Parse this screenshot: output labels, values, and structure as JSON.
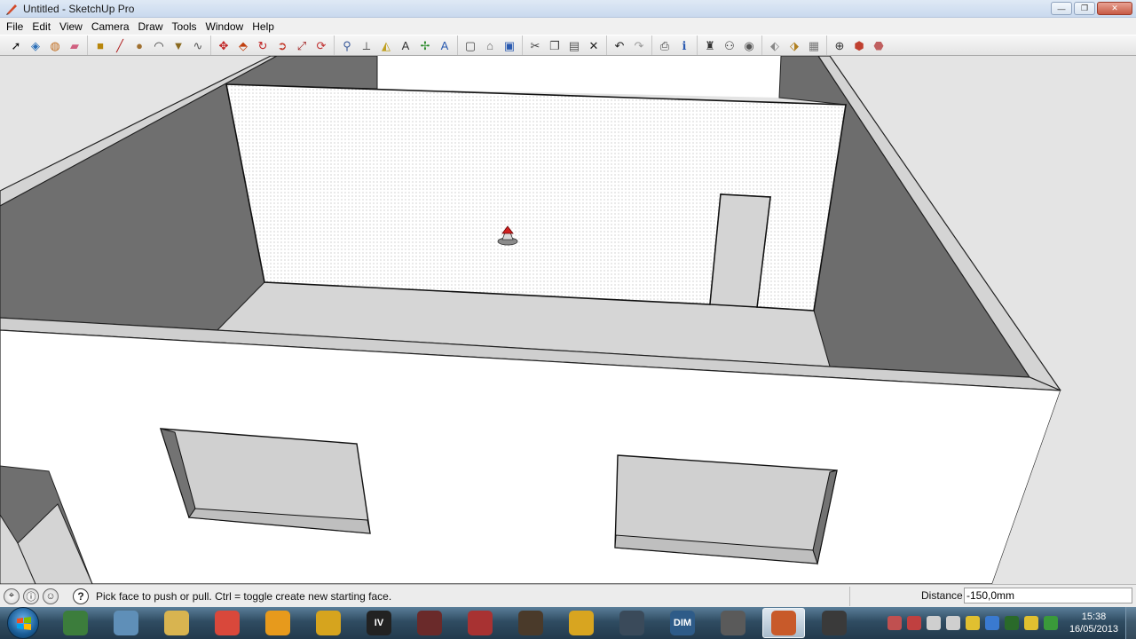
{
  "window": {
    "title": "Untitled - SketchUp Pro",
    "minimize": "—",
    "maximize": "❐",
    "close": "✕"
  },
  "menu": [
    "File",
    "Edit",
    "View",
    "Camera",
    "Draw",
    "Tools",
    "Window",
    "Help"
  ],
  "toolbar": {
    "groups": [
      [
        {
          "name": "select-tool",
          "glyph": "➚",
          "color": "#111111"
        },
        {
          "name": "component-tool",
          "glyph": "◈",
          "color": "#2a6fb8"
        },
        {
          "name": "paint-bucket-tool",
          "glyph": "◍",
          "color": "#c06a1a"
        },
        {
          "name": "eraser-tool",
          "glyph": "▰",
          "color": "#d06080"
        }
      ],
      [
        {
          "name": "rectangle-tool",
          "glyph": "■",
          "color": "#b8860b"
        },
        {
          "name": "line-tool",
          "glyph": "╱",
          "color": "#b02020"
        },
        {
          "name": "circle-tool",
          "glyph": "●",
          "color": "#a07030"
        },
        {
          "name": "arc-tool",
          "glyph": "◠",
          "color": "#333333"
        },
        {
          "name": "polygon-tool",
          "glyph": "▼",
          "color": "#8a6a20"
        },
        {
          "name": "freehand-tool",
          "glyph": "∿",
          "color": "#555555"
        }
      ],
      [
        {
          "name": "move-tool",
          "glyph": "✥",
          "color": "#c02020"
        },
        {
          "name": "push-pull-tool",
          "glyph": "⬘",
          "color": "#c04010"
        },
        {
          "name": "rotate-tool",
          "glyph": "↻",
          "color": "#c02020"
        },
        {
          "name": "follow-me-tool",
          "glyph": "➲",
          "color": "#c03020"
        },
        {
          "name": "scale-tool",
          "glyph": "⤢",
          "color": "#a02020"
        },
        {
          "name": "offset-tool",
          "glyph": "⟳",
          "color": "#c03030"
        }
      ],
      [
        {
          "name": "tape-measure-tool",
          "glyph": "⚲",
          "color": "#3a5a9a"
        },
        {
          "name": "dimension-tool",
          "glyph": "⟂",
          "color": "#555555"
        },
        {
          "name": "protractor-tool",
          "glyph": "◭",
          "color": "#c0a020"
        },
        {
          "name": "text-tool",
          "glyph": "A",
          "color": "#333333"
        },
        {
          "name": "axes-tool",
          "glyph": "✢",
          "color": "#2a8a2a"
        },
        {
          "name": "3d-text-tool",
          "glyph": "A",
          "color": "#2a5ab0"
        }
      ],
      [
        {
          "name": "new-icon",
          "glyph": "▢",
          "color": "#444444"
        },
        {
          "name": "open-icon",
          "glyph": "⌂",
          "color": "#666666"
        },
        {
          "name": "save-icon",
          "glyph": "▣",
          "color": "#2a5ab0"
        }
      ],
      [
        {
          "name": "cut-icon",
          "glyph": "✂",
          "color": "#444444"
        },
        {
          "name": "copy-icon",
          "glyph": "❐",
          "color": "#444444"
        },
        {
          "name": "paste-icon",
          "glyph": "▤",
          "color": "#555555"
        },
        {
          "name": "erase-icon",
          "glyph": "✕",
          "color": "#222222"
        }
      ],
      [
        {
          "name": "undo-icon",
          "glyph": "↶",
          "color": "#222222"
        },
        {
          "name": "redo-icon",
          "glyph": "↷",
          "color": "#999999"
        }
      ],
      [
        {
          "name": "print-icon",
          "glyph": "⎙",
          "color": "#444444"
        },
        {
          "name": "model-info-icon",
          "glyph": "ℹ",
          "color": "#2a5ab0"
        }
      ],
      [
        {
          "name": "position-camera-icon",
          "glyph": "♜",
          "color": "#333333"
        },
        {
          "name": "walk-icon",
          "glyph": "⚇",
          "color": "#333333"
        },
        {
          "name": "look-around-icon",
          "glyph": "◉",
          "color": "#555555"
        }
      ],
      [
        {
          "name": "section-plane-icon",
          "glyph": "⬖",
          "color": "#888888"
        },
        {
          "name": "display-section-planes-icon",
          "glyph": "⬗",
          "color": "#b08020"
        },
        {
          "name": "display-section-cuts-icon",
          "glyph": "▦",
          "color": "#777777"
        }
      ],
      [
        {
          "name": "orbit-icon",
          "glyph": "⊕",
          "color": "#333333"
        },
        {
          "name": "get-models-icon",
          "glyph": "⬢",
          "color": "#c04030"
        },
        {
          "name": "share-model-icon",
          "glyph": "⬣",
          "color": "#c06060"
        }
      ]
    ]
  },
  "status": {
    "hint": "Pick face to push or pull.  Ctrl = toggle create new starting face.",
    "geo_icon": "⌖",
    "credits_icon": "ⓘ",
    "user_icon": "☺",
    "help_glyph": "?",
    "distance_label": "Distance",
    "distance_value": "-150,0mm"
  },
  "taskbar": {
    "apps": [
      {
        "name": "task-app-terminal",
        "label": "",
        "color": "#3c7d3c"
      },
      {
        "name": "task-app-calculator",
        "label": "",
        "color": "#5f8fb8"
      },
      {
        "name": "task-app-explorer",
        "label": "",
        "color": "#d8b450"
      },
      {
        "name": "task-app-chrome",
        "label": "",
        "color": "#d9483b"
      },
      {
        "name": "task-app-media",
        "label": "",
        "color": "#e79a1c"
      },
      {
        "name": "task-app-autocad",
        "label": "",
        "color": "#d6a41e"
      },
      {
        "name": "task-app-gta-iv",
        "label": "IV",
        "color": "#222222"
      },
      {
        "name": "task-app-game-1",
        "label": "",
        "color": "#6a2a2a"
      },
      {
        "name": "task-app-game-2",
        "label": "",
        "color": "#a83232"
      },
      {
        "name": "task-app-game-3",
        "label": "",
        "color": "#4a3a2a"
      },
      {
        "name": "task-app-game-4",
        "label": "",
        "color": "#d8a520"
      },
      {
        "name": "task-app-game-5",
        "label": "",
        "color": "#3a4a5a"
      },
      {
        "name": "task-app-dim",
        "label": "DIM",
        "color": "#2e5b88"
      },
      {
        "name": "task-app-game-6",
        "label": "",
        "color": "#5a5a5a"
      },
      {
        "name": "task-app-sketchup",
        "label": "",
        "color": "#c85a2a"
      },
      {
        "name": "task-app-tool",
        "label": "",
        "color": "#3a3a3a"
      }
    ],
    "tray_icons": [
      "#c05050",
      "#c04040",
      "#cfcfcf",
      "#cfcfcf",
      "#e0c030",
      "#3a7ad0",
      "#2a6a2a",
      "#e0c030",
      "#3a9a3a"
    ],
    "time": "15:38",
    "date": "16/05/2013"
  }
}
